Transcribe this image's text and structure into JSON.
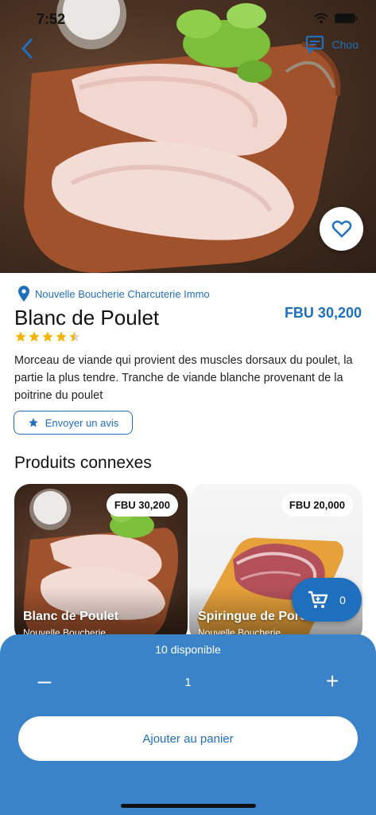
{
  "status": {
    "time": "7:52"
  },
  "header": {
    "right_label": "Choo"
  },
  "product": {
    "shop": "Nouvelle Boucherie Charcuterie Immo",
    "name": "Blanc de Poulet",
    "price": "FBU 30,200",
    "rating": 4.5,
    "description": "Morceau de viande qui provient des muscles dorsaux du poulet, la partie la plus tendre. Tranche de viande blanche provenant de la poitrine du poulet",
    "review_button": "Envoyer un avis"
  },
  "related": {
    "title": "Produits connexes",
    "items": [
      {
        "price": "FBU 30,200",
        "name": "Blanc de Poulet",
        "shop": "Nouvelle Boucherie ..."
      },
      {
        "price": "FBU 20,000",
        "name": "Spiringue de Porc",
        "shop": "Nouvelle Boucherie ..."
      }
    ]
  },
  "cart": {
    "count": "0"
  },
  "sheet": {
    "available": "10 disponible",
    "minus": "–",
    "quantity": "1",
    "plus": "+",
    "add_button": "Ajouter au panier"
  },
  "colors": {
    "accent": "#1f6fbf",
    "sheet": "#3a83c8",
    "star": "#f5b400"
  },
  "icons": [
    "wifi-icon",
    "battery-icon",
    "back-arrow-icon",
    "chat-icon",
    "heart-icon",
    "location-pin-icon",
    "star-icon",
    "cart-icon"
  ]
}
